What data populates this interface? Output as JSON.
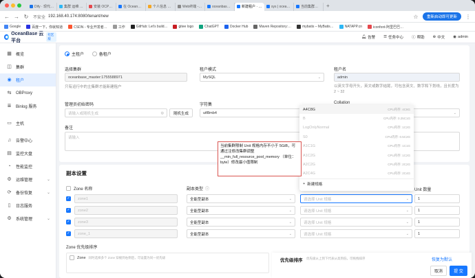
{
  "browser": {
    "tabs": [
      {
        "label": "Dify · 现代的 · DO",
        "color": "#1a73e8"
      },
      {
        "label": "集群 运维 · OC",
        "color": "#2db7f5"
      },
      {
        "label": "安装 OCP之…",
        "color": "#e5484d"
      },
      {
        "label": "在 OceanBase",
        "color": "#1677ff"
      },
      {
        "label": "个人信息 资料",
        "color": "#f5a623"
      },
      {
        "label": "Web终端 - Ju",
        "color": "#888"
      },
      {
        "label": "oceanbase_ma",
        "color": "#1677ff"
      },
      {
        "label": "新建租户 · Oc",
        "color": "#1677ff"
      },
      {
        "label": "sys | oceanb…",
        "color": "#1677ff"
      },
      {
        "label": "当前集群限制",
        "color": "#1677ff"
      }
    ],
    "insecure_label": "不安全",
    "url": "192.168.40.174:8080/tenant/new",
    "restart_label": "重新启动即可更新",
    "bookmarks": [
      "Google",
      "百度一下，你就知道",
      "CSDN - 专业开发者…",
      "工作",
      "GitHub: Let's build…",
      "gitee logo",
      "ChatGPT",
      "Docker Hub",
      "Maven Repository:…",
      "mybatis – MyBatis…",
      "NATAPP.cn",
      "iconfont-阿里巴巴…"
    ]
  },
  "header": {
    "app_title": "OceanBase 云平台",
    "badge": "社区版",
    "alarm": "告警",
    "tasks": "任务中心",
    "help": "帮助",
    "lang": "中文",
    "user": "admin"
  },
  "sidebar": [
    {
      "label": "概览",
      "icon": "dashboard-icon",
      "glyph": "▦"
    },
    {
      "label": "集群",
      "icon": "cluster-icon",
      "glyph": "◫"
    },
    {
      "label": "租户",
      "icon": "tenant-icon",
      "glyph": "◉",
      "active": true
    },
    {
      "label": "OBProxy",
      "icon": "proxy-icon",
      "glyph": "⇆"
    },
    {
      "label": "Binlog 服务",
      "icon": "binlog-icon",
      "glyph": "≣"
    },
    {
      "label": "主机",
      "icon": "host-icon",
      "glyph": "▭"
    },
    {
      "label": "告警中心",
      "icon": "bell-icon",
      "glyph": "♫"
    },
    {
      "label": "监控大盘",
      "icon": "monitor-icon",
      "glyph": "▤"
    },
    {
      "label": "性能监控",
      "icon": "performance-icon",
      "glyph": "◔"
    },
    {
      "label": "运维管理",
      "icon": "ops-icon",
      "glyph": "⚙",
      "arrow": true
    },
    {
      "label": "备份恢复",
      "icon": "backup-icon",
      "glyph": "⟳",
      "arrow": true
    },
    {
      "label": "日志服务",
      "icon": "log-icon",
      "glyph": "▯"
    },
    {
      "label": "系统管理",
      "icon": "system-icon",
      "glyph": "⚙",
      "arrow": true
    }
  ],
  "form": {
    "role_primary": "主租户",
    "role_standby": "备租户",
    "cluster_label": "选择集群",
    "cluster_value": "oceanbase_master:1755588971",
    "cluster_hint": "只有运行中的主集群才能新建租户",
    "mode_label": "租户模式",
    "mode_value": "MySQL",
    "name_label": "租户名",
    "name_value": "admin",
    "name_hint": "以英文字母开头，英文或数字结尾，可包含英文、数字和下划线，且长度为 2 ~ 32",
    "pwd_label": "管理员初始密码",
    "pwd_placeholder": "请输入或随机生成",
    "random_btn": "随机生成",
    "charset_label": "字符集",
    "charset_value": "utf8mb4",
    "collation_label": "Collation",
    "remark_label": "备注",
    "remark_placeholder": "请输入"
  },
  "replica": {
    "title": "副本设置",
    "col_zone": "Zone 名称",
    "col_type": "副本类型",
    "col_count": "Unit 数量",
    "rows": [
      {
        "zone": "zone1",
        "type": "全能型副本",
        "spec_placeholder": "请选择 Unit 规格",
        "count": "1"
      },
      {
        "zone": "zone2",
        "type": "全能型副本",
        "spec_placeholder": "请选择 Unit 规格",
        "count": "1"
      },
      {
        "zone": "zone3",
        "type": "全能型副本",
        "spec_placeholder": "请选择 Unit 规格",
        "count": "1"
      },
      {
        "zone": "zone_1",
        "type": "全能型副本",
        "spec_placeholder": "请选择 Unit 规格",
        "count": "1"
      }
    ],
    "priority_title": "Zone 优先级排序",
    "priority_zone": "Zone",
    "priority_hint": "同时选择多个 Zone 穿梭到右侧后，可设置为同一优先级",
    "priority_sort": "优先级排序",
    "priority_sort_hint": "优先级从上到下代表从高到低，可拖拽排序",
    "restore_default": "恢复为默认"
  },
  "dropdown": {
    "items": [
      {
        "name": "A4C8G",
        "spec": "CPU内存: 4C8G",
        "dim": false
      },
      {
        "name": "B",
        "spec": "CPU内存: 0.25C1G",
        "dim": true
      },
      {
        "name": "LogOnlyNormal",
        "spec": "CPU内存: 1C2G",
        "dim": true
      },
      {
        "name": "S0",
        "spec": "CPU内存: 0.5C2G",
        "dim": true
      },
      {
        "name": "A1C1G",
        "spec": "CPU内存: 1C1G",
        "dim": true
      },
      {
        "name": "A1C2G",
        "spec": "CPU内存: 1C2G",
        "dim": true
      },
      {
        "name": "A2C2G",
        "spec": "CPU内存: 2C2G",
        "dim": true
      },
      {
        "name": "A2C4G",
        "spec": "CPU内存: 2C4G",
        "dim": true
      }
    ],
    "new_spec": "新建规格"
  },
  "tooltip": "当前集群限制 Unit 规格内存不小于 5GiB，可通过注修改集群调整 __min_full_resource_pool_memory （单位：byte）修改最小值限制",
  "footer": {
    "cancel": "取消",
    "submit": "提 交"
  }
}
